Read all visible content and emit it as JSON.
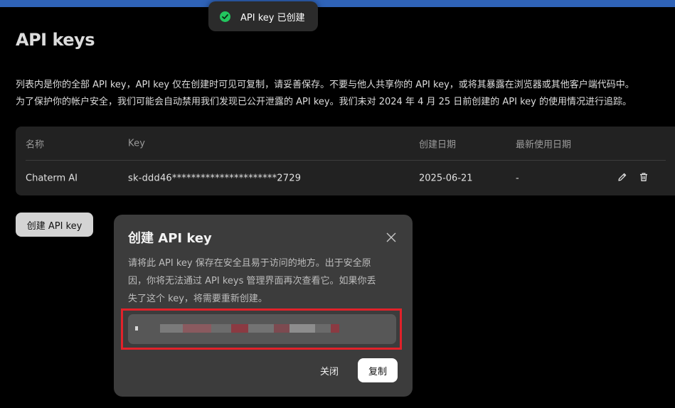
{
  "toast": {
    "message": "API key 已创建",
    "icon": "check-circle-icon",
    "accent": "#22c55e"
  },
  "page": {
    "title": "API keys",
    "description_lines": [
      "列表内是你的全部 API key，API key 仅在创建时可见可复制，请妥善保存。不要与他人共享你的 API key，或将其暴露在浏览器或其他客户端代码中。",
      "为了保护你的帐户安全，我们可能会自动禁用我们发现已公开泄露的 API key。我们未对 2024 年 4 月 25 日前创建的 API key 的使用情况进行追踪。"
    ]
  },
  "table": {
    "headers": {
      "name": "名称",
      "key": "Key",
      "created": "创建日期",
      "last_used": "最新使用日期"
    },
    "rows": [
      {
        "name": "Chaterm AI",
        "key": "sk-ddd46**********************2729",
        "created": "2025-06-21",
        "last_used": "-"
      }
    ]
  },
  "create_button": {
    "label": "创建 API key"
  },
  "modal": {
    "title": "创建 API key",
    "text_lines": [
      "请将此 API key 保存在安全且易于访问的地方。出于安全原",
      "因，你将无法通过 API keys 管理界面再次查看它。如果你丢",
      "失了这个 key，将需要重新创建。"
    ],
    "close_label": "关闭",
    "copy_label": "复制",
    "highlight_color": "#e1222a"
  },
  "colors": {
    "top_accent": "#2f63b8",
    "background": "#000000"
  }
}
